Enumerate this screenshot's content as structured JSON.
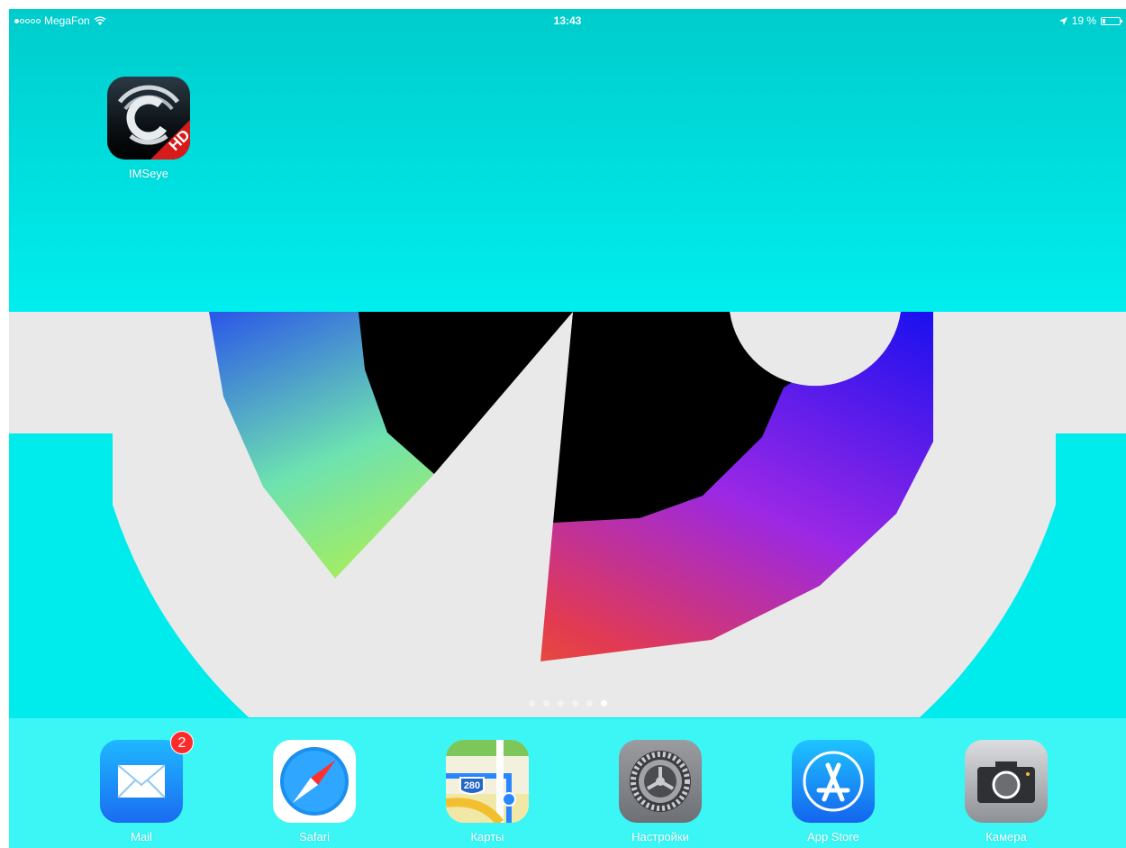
{
  "status_bar": {
    "signal_strength": "1/5",
    "carrier": "MegaFon",
    "time": "13:43",
    "battery_percent": "19 %",
    "battery_level": 0.19
  },
  "home_apps": [
    {
      "label": "IMSeye",
      "icon": "imseye-app-icon",
      "icon_text": "HD"
    }
  ],
  "page_indicator": {
    "pages": 6,
    "active": 6
  },
  "dock": {
    "apps": [
      {
        "label": "Mail",
        "icon": "mail-icon",
        "badge": "2"
      },
      {
        "label": "Safari",
        "icon": "compass-icon"
      },
      {
        "label": "Карты",
        "icon": "maps-icon",
        "icon_text": "280"
      },
      {
        "label": "Настройки",
        "icon": "gear-icon"
      },
      {
        "label": "App Store",
        "icon": "app-store-icon"
      },
      {
        "label": "Камера",
        "icon": "camera-icon"
      }
    ]
  },
  "colors": {
    "wallpaper_cyan": "#00e8e8",
    "wallpaper_gray": "#e9e9e9",
    "badge_red": "#ff2b2b"
  }
}
